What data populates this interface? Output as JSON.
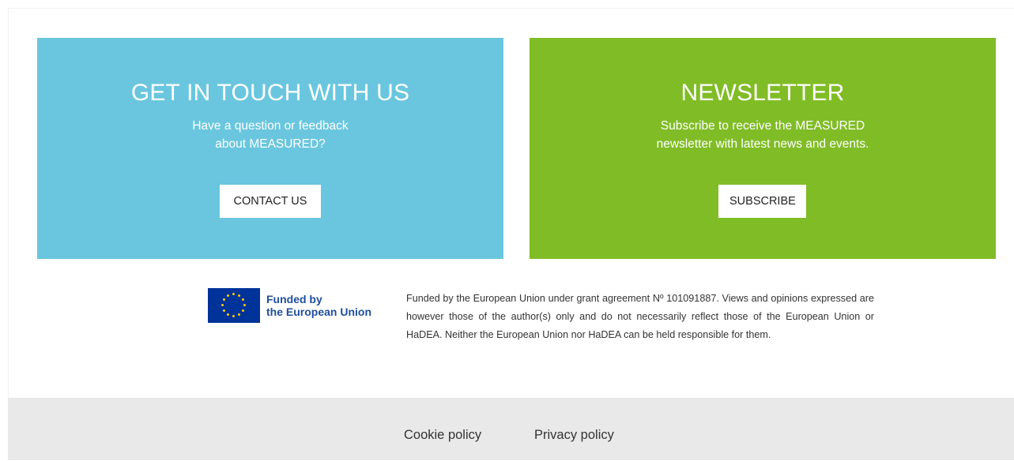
{
  "contact": {
    "title": "GET IN TOUCH WITH US",
    "subtitle": "Have a question or feedback\nabout MEASURED?",
    "button_label": "CONTACT US"
  },
  "newsletter": {
    "title": "NEWSLETTER",
    "subtitle": "Subscribe to receive the MEASURED\nnewsletter with latest news and events.",
    "button_label": "SUBSCRIBE"
  },
  "funding": {
    "logo_text_line1": "Funded by",
    "logo_text_line2": "the European Union",
    "disclaimer": "Funded by the European Union under grant agreement Nº 101091887. Views and opinions expressed are however those of the author(s) only and do not necessarily reflect those of the European Union or HaDEA. Neither the European Union nor HaDEA can be held responsible for them."
  },
  "footer": {
    "cookie_policy": "Cookie policy",
    "privacy_policy": "Privacy policy"
  },
  "colors": {
    "contact_bg": "#6ac6de",
    "newsletter_bg": "#80bc26",
    "eu_blue": "#003399",
    "eu_gold": "#ffcc00"
  }
}
